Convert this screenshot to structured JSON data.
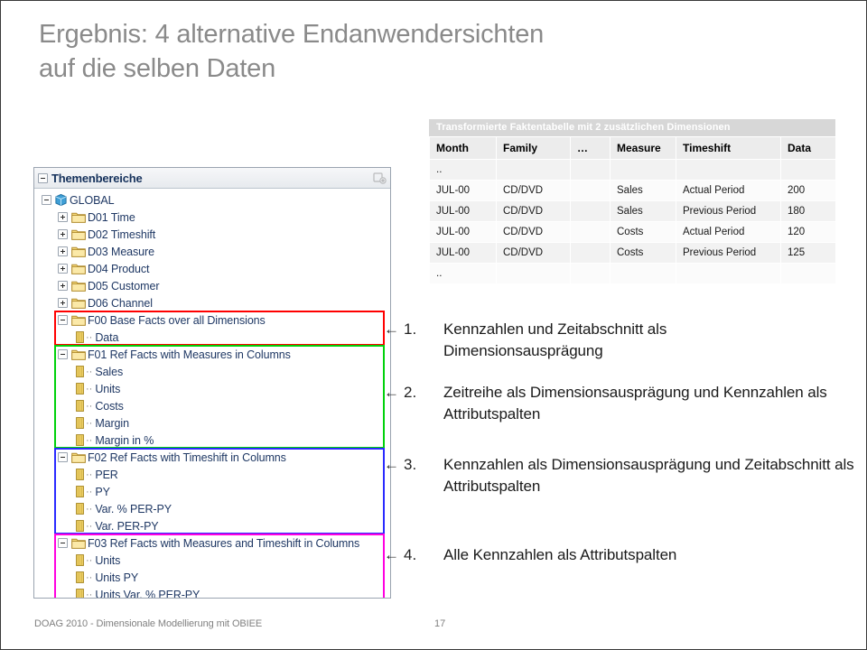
{
  "slide": {
    "title_lines": [
      "Ergebnis: 4 alternative Endanwendersichten",
      "auf die selben Daten"
    ],
    "title_color": "#8a8a8a"
  },
  "fact_table": {
    "caption": "Transformierte Faktentabelle  mit 2 zusätzlichen Dimensionen",
    "caption_bg": "#d7d7d7",
    "columns": [
      "Month",
      "Family",
      "…",
      "Measure",
      "Timeshift",
      "Data"
    ],
    "rows": [
      {
        "month": "..",
        "family": "",
        "dots": "",
        "measure": "",
        "timeshift": "",
        "data": ""
      },
      {
        "month": "JUL-00",
        "family": "CD/DVD",
        "dots": "",
        "measure": "Sales",
        "timeshift": "Actual Period",
        "data": "200"
      },
      {
        "month": "JUL-00",
        "family": "CD/DVD",
        "dots": "",
        "measure": "Sales",
        "timeshift": "Previous Period",
        "data": "180"
      },
      {
        "month": "JUL-00",
        "family": "CD/DVD",
        "dots": "",
        "measure": "Costs",
        "timeshift": "Actual Period",
        "data": "120"
      },
      {
        "month": "JUL-00",
        "family": "CD/DVD",
        "dots": "",
        "measure": "Costs",
        "timeshift": "Previous Period",
        "data": "125"
      },
      {
        "month": "..",
        "family": "",
        "dots": "",
        "measure": "",
        "timeshift": "",
        "data": ""
      }
    ]
  },
  "tree": {
    "header_title": "Themenbereiche",
    "header_icon": "add-subject-area-icon",
    "nodes": [
      {
        "label": "GLOBAL",
        "icon": "cube-icon",
        "level": 0,
        "state": "expanded"
      },
      {
        "label": "D01 Time",
        "icon": "folder-icon",
        "level": 1,
        "state": "collapsed"
      },
      {
        "label": "D02 Timeshift",
        "icon": "folder-icon",
        "level": 1,
        "state": "collapsed"
      },
      {
        "label": "D03 Measure",
        "icon": "folder-icon",
        "level": 1,
        "state": "collapsed"
      },
      {
        "label": "D04 Product",
        "icon": "folder-icon",
        "level": 1,
        "state": "collapsed"
      },
      {
        "label": "D05 Customer",
        "icon": "folder-icon",
        "level": 1,
        "state": "collapsed"
      },
      {
        "label": "D06 Channel",
        "icon": "folder-icon",
        "level": 1,
        "state": "collapsed"
      },
      {
        "label": "F00 Base Facts over all Dimensions",
        "icon": "folder-icon",
        "level": 1,
        "state": "expanded"
      },
      {
        "label": "Data",
        "icon": "column-icon",
        "level": 2,
        "state": "leaf"
      },
      {
        "label": "F01 Ref Facts with Measures in Columns",
        "icon": "folder-icon",
        "level": 1,
        "state": "expanded"
      },
      {
        "label": "Sales",
        "icon": "column-icon",
        "level": 2,
        "state": "leaf"
      },
      {
        "label": "Units",
        "icon": "column-icon",
        "level": 2,
        "state": "leaf"
      },
      {
        "label": "Costs",
        "icon": "column-icon",
        "level": 2,
        "state": "leaf"
      },
      {
        "label": "Margin",
        "icon": "column-icon",
        "level": 2,
        "state": "leaf"
      },
      {
        "label": "Margin in %",
        "icon": "column-icon",
        "level": 2,
        "state": "leaf"
      },
      {
        "label": "F02 Ref Facts with Timeshift in Columns",
        "icon": "folder-icon",
        "level": 1,
        "state": "expanded"
      },
      {
        "label": "PER",
        "icon": "column-icon",
        "level": 2,
        "state": "leaf"
      },
      {
        "label": "PY",
        "icon": "column-icon",
        "level": 2,
        "state": "leaf"
      },
      {
        "label": "Var. % PER-PY",
        "icon": "column-icon",
        "level": 2,
        "state": "leaf"
      },
      {
        "label": "Var. PER-PY",
        "icon": "column-icon",
        "level": 2,
        "state": "leaf"
      },
      {
        "label": "F03 Ref Facts with Measures and Timeshift in Columns",
        "icon": "folder-icon",
        "level": 1,
        "state": "expanded"
      },
      {
        "label": "Units",
        "icon": "column-icon",
        "level": 2,
        "state": "leaf"
      },
      {
        "label": "Units PY",
        "icon": "column-icon",
        "level": 2,
        "state": "leaf"
      },
      {
        "label": "Units Var. % PER-PY",
        "icon": "column-icon",
        "level": 2,
        "state": "leaf"
      }
    ],
    "group_highlights": [
      {
        "name": "F00",
        "color": "#ff0000"
      },
      {
        "name": "F01",
        "color": "#00d10a"
      },
      {
        "name": "F02",
        "color": "#2a2aff"
      },
      {
        "name": "F03",
        "color": "#ff00e0"
      }
    ]
  },
  "points": [
    {
      "arrow": "←",
      "number": "1.",
      "text": "Kennzahlen und Zeitabschnitt als Dimensionsausprägung"
    },
    {
      "arrow": "←",
      "number": "2.",
      "text": "Zeitreihe als Dimensionsausprägung und Kennzahlen als Attributspalten"
    },
    {
      "arrow": "←",
      "number": "3.",
      "text": "Kennzahlen als Dimensionsausprägung und Zeitabschnitt als Attributspalten"
    },
    {
      "arrow": "←",
      "number": "4.",
      "text": "Alle Kennzahlen als Attributspalten"
    }
  ],
  "footer": {
    "text": "DOAG 2010 - Dimensionale Modellierung mit OBIEE",
    "page": "17"
  }
}
